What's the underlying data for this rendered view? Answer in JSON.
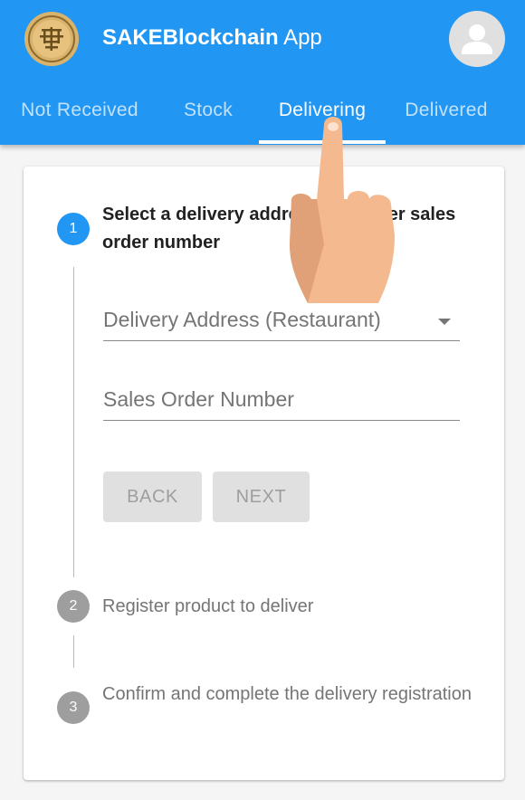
{
  "header": {
    "app_name_bold": "SAKEBlockchain",
    "app_name_suffix": "App",
    "logo_icon": "sake-logo-icon",
    "avatar_icon": "person-icon"
  },
  "tabs": [
    {
      "label": "Not Received",
      "active": false
    },
    {
      "label": "Stock",
      "active": false
    },
    {
      "label": "Delivering",
      "active": true
    },
    {
      "label": "Delivered",
      "active": false
    }
  ],
  "stepper": {
    "steps": [
      {
        "number": "1",
        "label": "Select a delivery address and enter sales order number",
        "active": true
      },
      {
        "number": "2",
        "label": "Register product to deliver",
        "active": false
      },
      {
        "number": "3",
        "label": "Confirm and complete the delivery registration",
        "active": false
      }
    ],
    "delivery_address_label": "Delivery Address (Restaurant)",
    "sales_order_label": "Sales Order Number",
    "back_label": "BACK",
    "next_label": "NEXT"
  },
  "colors": {
    "primary": "#2196f3",
    "inactive_step": "#9e9e9e",
    "disabled_button": "#e0e0e0"
  }
}
